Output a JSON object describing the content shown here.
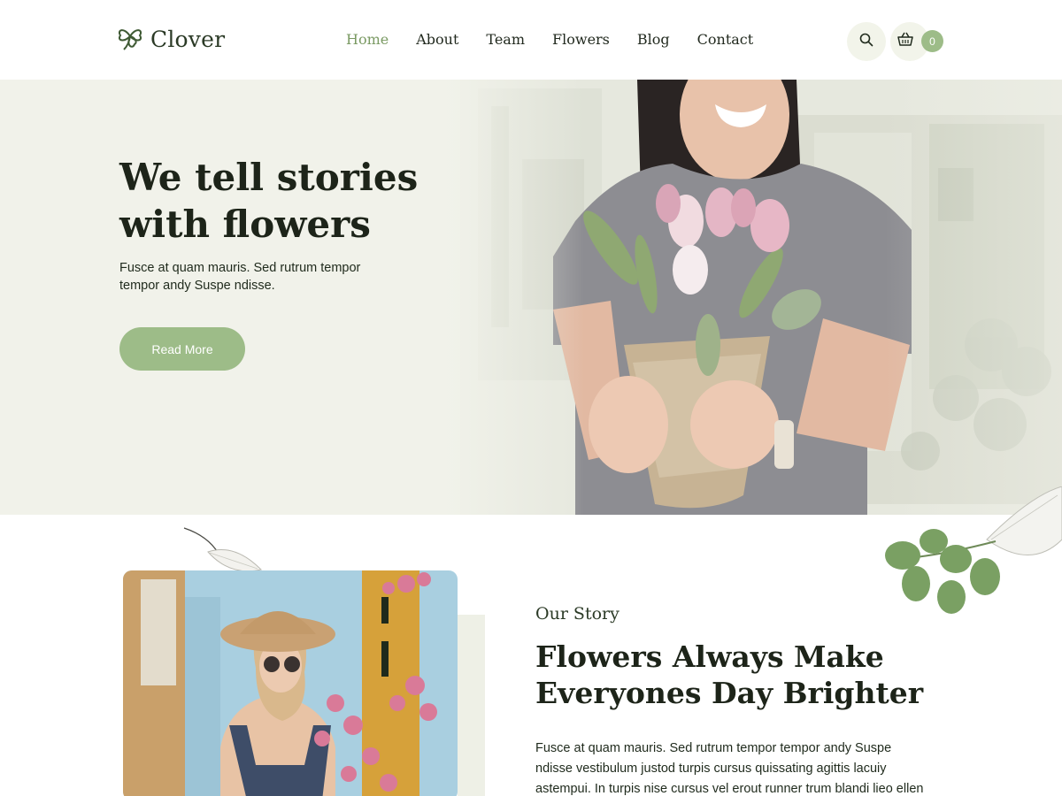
{
  "header": {
    "logo_text": "Clover",
    "nav": [
      {
        "label": "Home",
        "active": true
      },
      {
        "label": "About"
      },
      {
        "label": "Team"
      },
      {
        "label": "Flowers"
      },
      {
        "label": "Blog"
      },
      {
        "label": "Contact"
      }
    ],
    "cart_count": "0",
    "icons": [
      "clover-logo-icon",
      "search-icon",
      "basket-icon"
    ]
  },
  "hero": {
    "title_line1": "We tell stories",
    "title_line2": "with flowers",
    "text": "Fusce at quam mauris. Sed rutrum tempor tempor andy Suspe ndisse.",
    "button_label": "Read More"
  },
  "story": {
    "kicker": "Our Story",
    "title_line1": "Flowers Always Make",
    "title_line2": "Everyones Day Brighter",
    "text_lines": [
      "Fusce at quam mauris. Sed rutrum tempor tempor andy Suspe",
      "ndisse vestibulum justod turpis cursus quissating agittis lacuiy",
      "astempui. In turpis nise cursus vel erout runner trum blandi lieo ellen"
    ]
  },
  "colors": {
    "accent": "#9dbc88",
    "active_nav": "#7a9a63",
    "hero_bg": "#eef0e6",
    "text": "#1f2a1c"
  }
}
